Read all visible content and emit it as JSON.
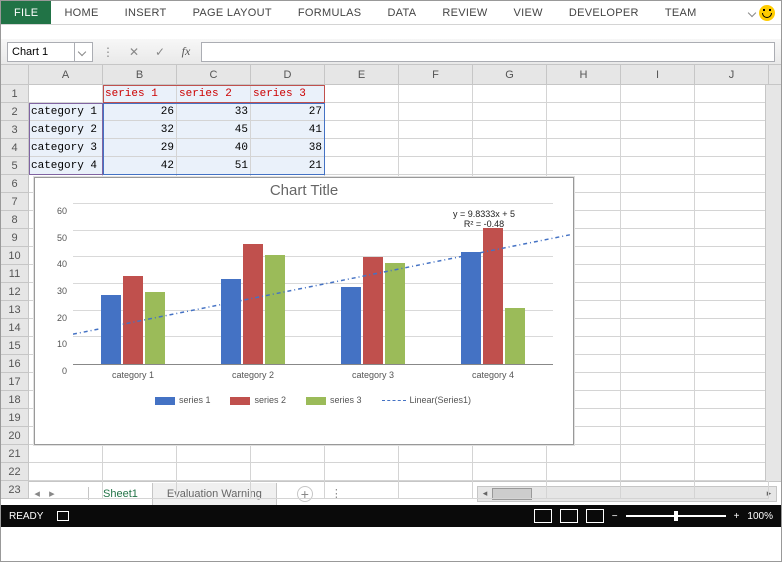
{
  "ribbon": {
    "file": "FILE",
    "tabs": [
      "HOME",
      "INSERT",
      "PAGE LAYOUT",
      "FORMULAS",
      "DATA",
      "REVIEW",
      "VIEW",
      "DEVELOPER",
      "TEAM"
    ]
  },
  "name_box": "Chart 1",
  "columns": [
    "A",
    "B",
    "C",
    "D",
    "E",
    "F",
    "G",
    "H",
    "I",
    "J"
  ],
  "row_count": 23,
  "table": {
    "headers": [
      "series 1",
      "series 2",
      "series 3"
    ],
    "categories": [
      "category 1",
      "category 2",
      "category 3",
      "category 4"
    ],
    "values": [
      [
        26,
        33,
        27
      ],
      [
        32,
        45,
        41
      ],
      [
        29,
        40,
        38
      ],
      [
        42,
        51,
        21
      ]
    ]
  },
  "chart_data": {
    "type": "bar",
    "title": "Chart Title",
    "categories": [
      "category 1",
      "category 2",
      "category 3",
      "category 4"
    ],
    "series": [
      {
        "name": "series 1",
        "values": [
          26,
          32,
          29,
          42
        ],
        "color": "#4472c4"
      },
      {
        "name": "series 2",
        "values": [
          33,
          45,
          40,
          51
        ],
        "color": "#c0504d"
      },
      {
        "name": "series 3",
        "values": [
          27,
          41,
          38,
          21
        ],
        "color": "#9bbb59"
      }
    ],
    "ylim": [
      0,
      60
    ],
    "ytick_step": 10,
    "trendline": {
      "label": "Linear(Series1)",
      "equation": "y = 9.8333x + 5",
      "r2": "R² = -0.48"
    }
  },
  "sheets": {
    "active": "Sheet1",
    "other": "Evaluation Warning"
  },
  "status": {
    "ready": "READY",
    "zoom": "100%"
  }
}
